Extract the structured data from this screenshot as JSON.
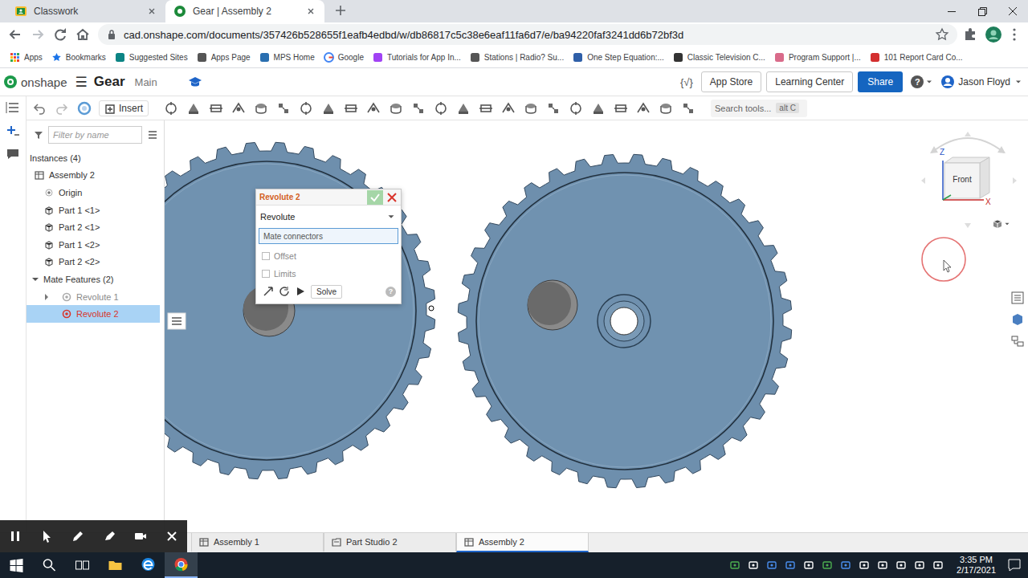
{
  "browser": {
    "tabs": [
      {
        "label": "Classwork",
        "selected": false
      },
      {
        "label": "Gear | Assembly 2",
        "selected": true
      }
    ],
    "url": "cad.onshape.com/documents/357426b528655f1eafb4edbd/w/db86817c5c38e6eaf11fa6d7/e/ba94220faf3241dd6b72bf3d",
    "bookmarks": [
      "Apps",
      "Bookmarks",
      "Suggested Sites",
      "Apps Page",
      "MPS Home",
      "Google",
      "Tutorials for App In...",
      "Stations | Radio? Su...",
      "One Step Equation:...",
      "Classic Television C...",
      "Program Support |...",
      "101 Report Card Co..."
    ]
  },
  "app": {
    "logo": "onshape",
    "menu": "☰",
    "document": "Gear",
    "workspace": "Main",
    "code_icon": "{√}",
    "app_store": "App Store",
    "learning_center": "Learning Center",
    "share": "Share",
    "help": "?",
    "user": "Jason Floyd"
  },
  "toolbar": {
    "insert": "Insert",
    "search_placeholder": "Search tools...",
    "shortcut": "alt C"
  },
  "panel": {
    "filter_placeholder": "Filter by name",
    "instances_title": "Instances (4)",
    "instances": [
      {
        "label": "Assembly 2",
        "kind": "assembly"
      },
      {
        "label": "Origin",
        "kind": "origin"
      },
      {
        "label": "Part 1 <1>",
        "kind": "part"
      },
      {
        "label": "Part 2 <1>",
        "kind": "part"
      },
      {
        "label": "Part 1 <2>",
        "kind": "part"
      },
      {
        "label": "Part 2 <2>",
        "kind": "part"
      }
    ],
    "mates_title": "Mate Features (2)",
    "mates_expanded": true,
    "mates": [
      {
        "label": "Revolute 1",
        "selected": false,
        "expandable": true,
        "dimmed": true,
        "error": false
      },
      {
        "label": "Revolute 2",
        "selected": true,
        "expandable": false,
        "dimmed": false,
        "error": true
      }
    ]
  },
  "dialog": {
    "title": "Revolute 2",
    "type": "Revolute",
    "field": "Mate connectors",
    "field_focused": true,
    "options": [
      {
        "label": "Offset",
        "checked": false
      },
      {
        "label": "Limits",
        "checked": false
      }
    ],
    "solve": "Solve",
    "help": "?"
  },
  "view_cube": {
    "face": "Front",
    "z_axis": "Z",
    "x_axis": "X"
  },
  "bottom_tabs": [
    {
      "label": "Assembly 1",
      "kind": "assembly",
      "selected": false
    },
    {
      "label": "Part Studio 2",
      "kind": "partstudio",
      "selected": false
    },
    {
      "label": "Assembly 2",
      "kind": "assembly",
      "selected": true
    }
  ],
  "taskbar": {
    "apps": [
      {
        "selected": false
      },
      {
        "selected": false
      },
      {
        "selected": true
      }
    ],
    "time": "3:35 PM",
    "date": "2/17/2021"
  }
}
